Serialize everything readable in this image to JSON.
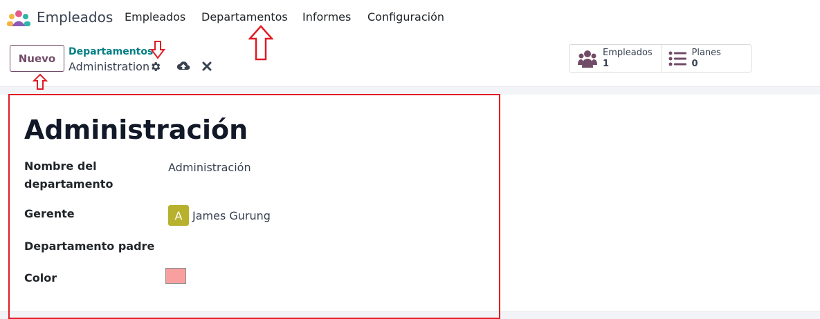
{
  "navbar": {
    "app_name": "Empleados",
    "menu": [
      {
        "label": "Empleados"
      },
      {
        "label": "Departamentos"
      },
      {
        "label": "Informes"
      },
      {
        "label": "Configuración"
      }
    ]
  },
  "control_panel": {
    "new_button": "Nuevo",
    "breadcrumb_parent": "Departamentos",
    "breadcrumb_current": "Administration",
    "icons": [
      "gear-icon",
      "cloud-upload-icon",
      "close-icon"
    ],
    "stat_buttons": [
      {
        "label": "Empleados",
        "value": "1",
        "icon": "users-icon"
      },
      {
        "label": "Planes",
        "value": "0",
        "icon": "list-icon"
      }
    ]
  },
  "form": {
    "title": "Administración",
    "fields": [
      {
        "label_line1": "Nombre del",
        "label_line2": "departamento",
        "value": "Administración"
      },
      {
        "label": "Gerente",
        "value": "James Gurung",
        "avatar_letter": "A"
      },
      {
        "label": "Departamento padre",
        "value": ""
      },
      {
        "label": "Color",
        "color": "#f8a0a0"
      }
    ]
  },
  "colors": {
    "brand": "#714b67",
    "link": "#017e84",
    "annotation": "#e01b24",
    "avatar": "#b8b12e"
  }
}
